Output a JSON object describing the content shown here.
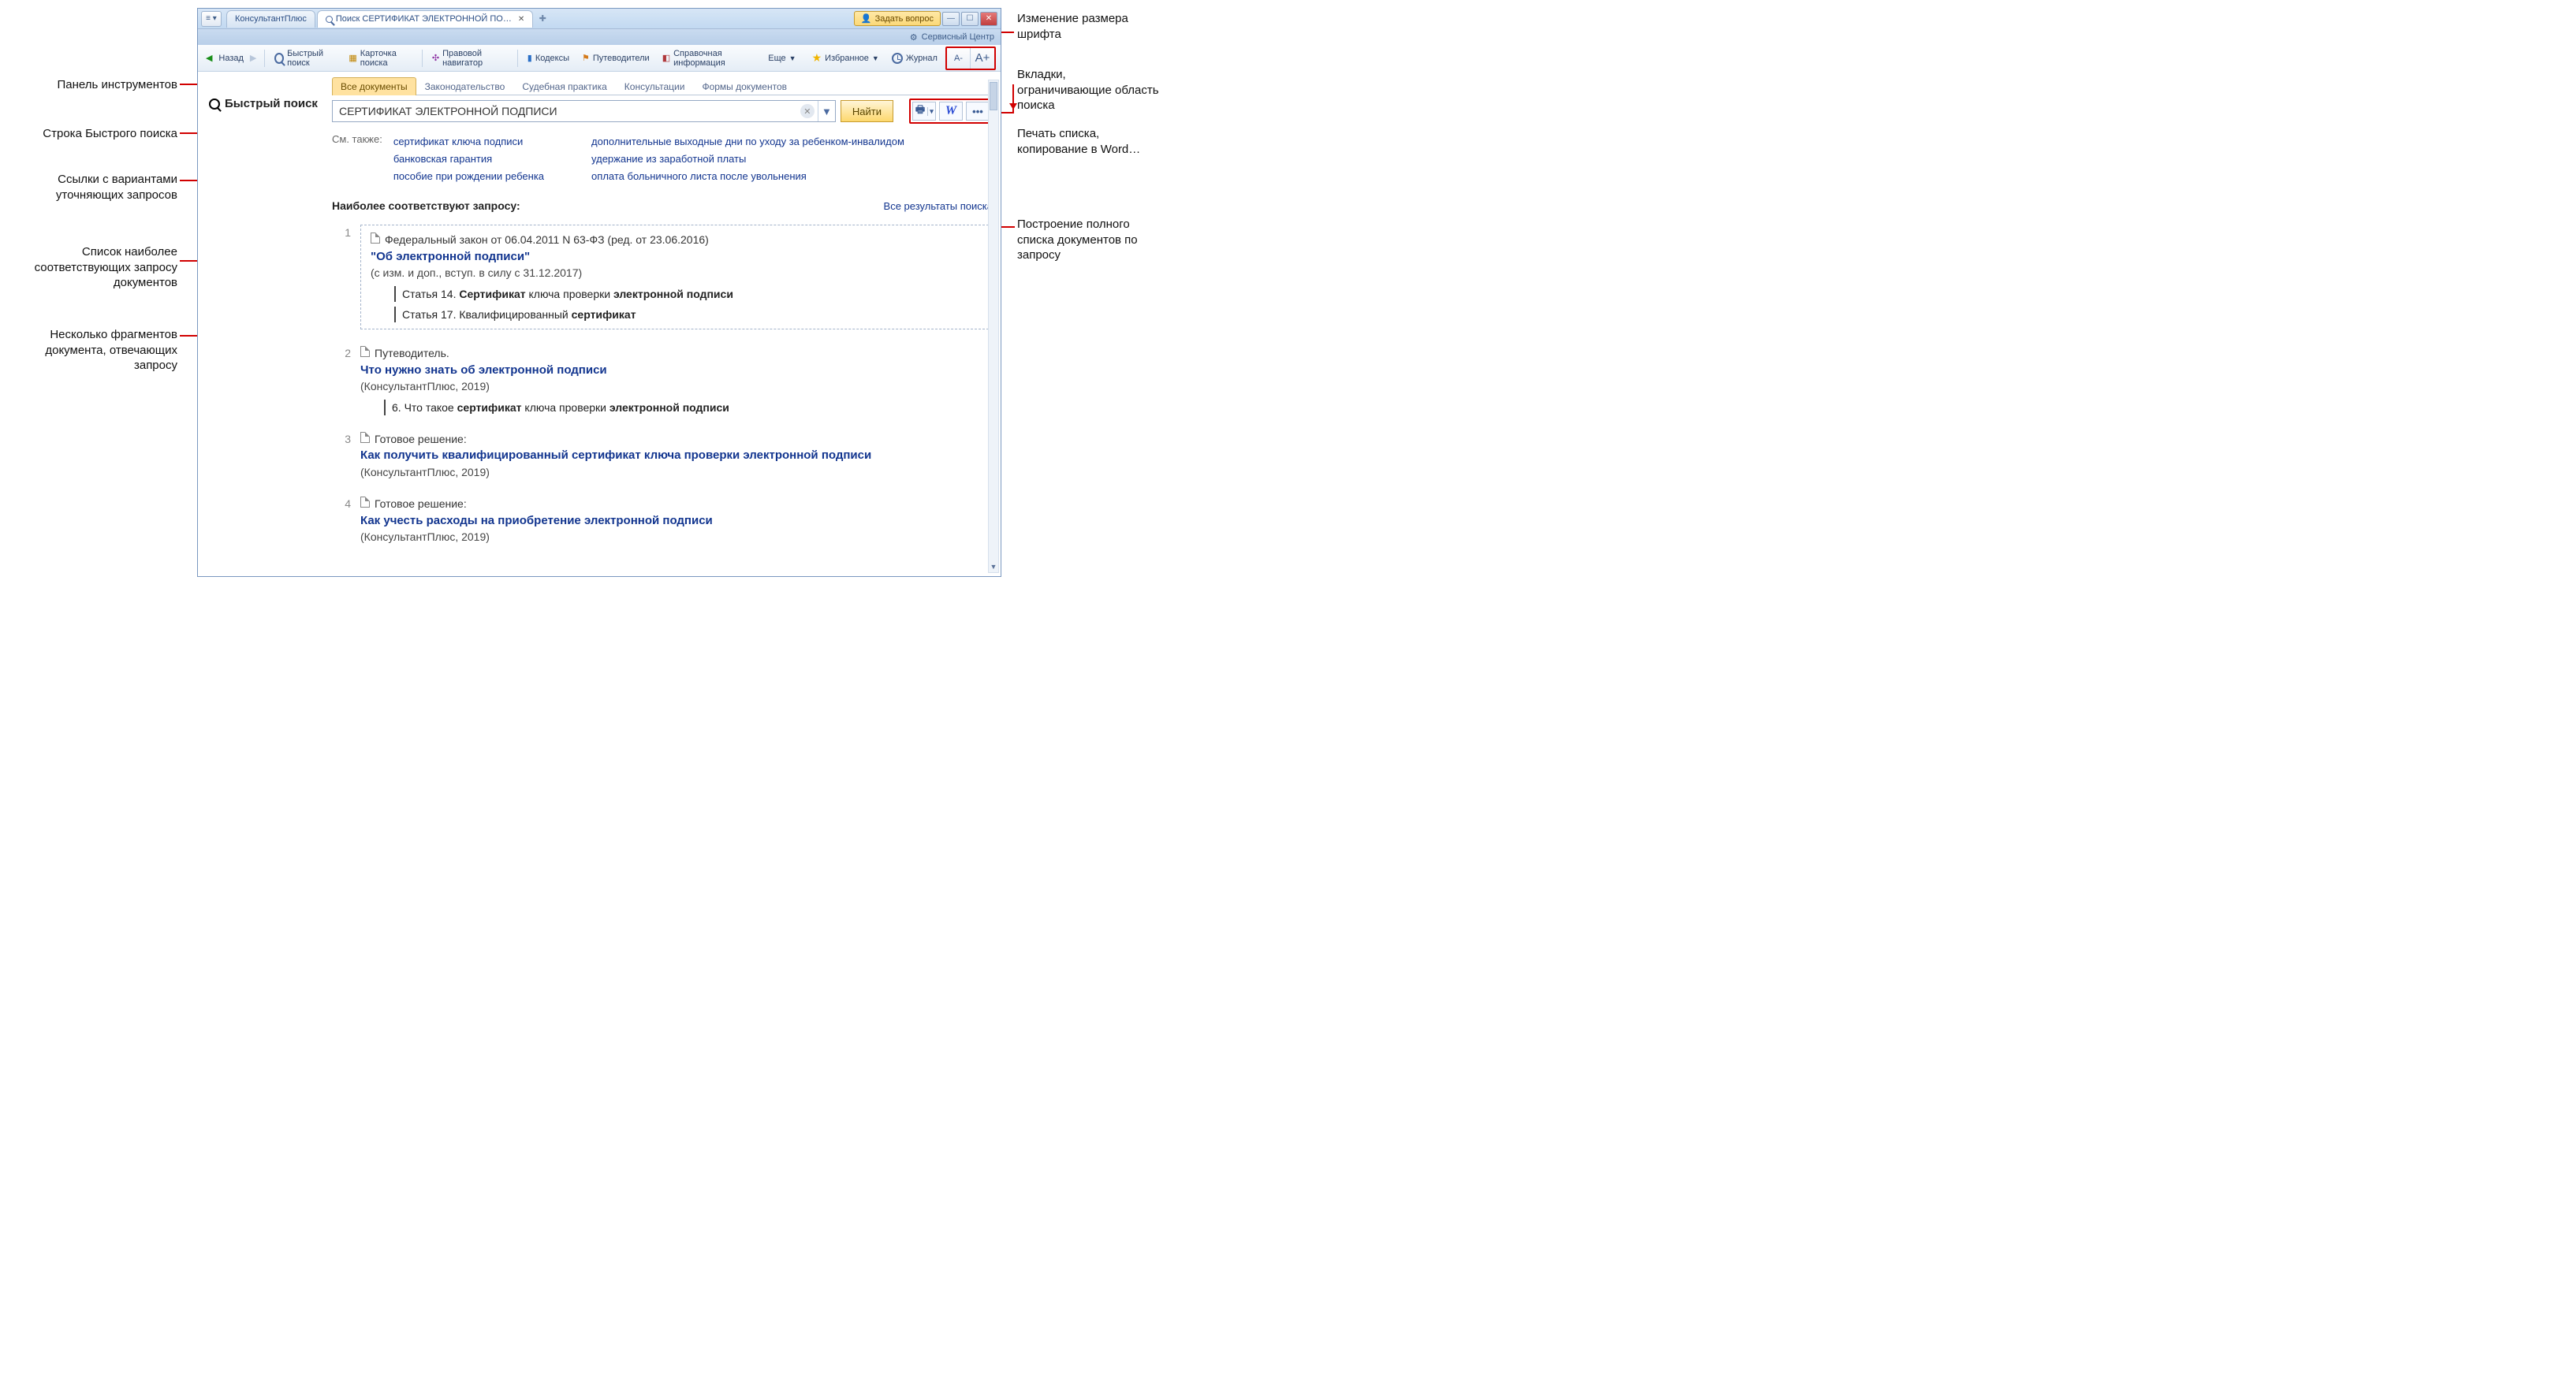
{
  "annotations": {
    "left": [
      "Панель инструментов",
      "Строка Быстрого поиска",
      "Ссылки с вариантами уточняющих запросов",
      "Список наиболее соответствующих запросу документов",
      "Несколько фрагментов документа, отвечающих запросу"
    ],
    "right": [
      "Изменение размера шрифта",
      "Вкладки, ограничивающие область поиска",
      "Печать списка, копирование в Word…",
      "Построение полного списка документов по запросу"
    ]
  },
  "titlebar": {
    "product": "КонсультантПлюс",
    "tab_prefix": "Поиск ",
    "tab_text": "СЕРТИФИКАТ ЭЛЕКТРОННОЙ ПО…",
    "ask": "Задать вопрос",
    "service": "Сервисный Центр"
  },
  "toolbar": {
    "back": "Назад",
    "quick_search": "Быстрый поиск",
    "card_search": "Карточка поиска",
    "law_nav": "Правовой навигатор",
    "codices": "Кодексы",
    "guides": "Путеводители",
    "reference": "Справочная информация",
    "more": "Еще",
    "favorites": "Избранное",
    "journal": "Журнал",
    "font_minus": "A-",
    "font_plus": "A+"
  },
  "quick_search_label": "Быстрый поиск",
  "scope_tabs": [
    "Все документы",
    "Законодательство",
    "Судебная практика",
    "Консультации",
    "Формы документов"
  ],
  "search": {
    "value": "СЕРТИФИКАТ ЭЛЕКТРОННОЙ ПОДПИСИ",
    "find": "Найти"
  },
  "actions": {
    "w": "W",
    "more": "•••"
  },
  "see_also": {
    "label": "См. также:",
    "col1": [
      "сертификат ключа подписи",
      "банковская гарантия",
      "пособие при рождении ребенка"
    ],
    "col2": [
      "дополнительные выходные дни по уходу за ребенком-инвалидом",
      "удержание из заработной платы",
      "оплата больничного листа после увольнения"
    ]
  },
  "results": {
    "header": "Наиболее соответствуют запросу:",
    "all_link": "Все результаты поиска",
    "items": [
      {
        "num": "1",
        "meta": "Федеральный закон от 06.04.2011 N 63-ФЗ (ред. от 23.06.2016)",
        "title_pre": "\"Об ",
        "title_hl": "электронной подписи",
        "title_post": "\"",
        "sub": "(с изм. и доп., вступ. в силу с 31.12.2017)",
        "frags": [
          {
            "pre": "Статья 14. ",
            "b1": "Сертификат",
            "mid": " ключа проверки ",
            "b2": "электронной подписи",
            "post": ""
          },
          {
            "pre": "Статья 17. Квалифицированный ",
            "b1": "сертификат",
            "mid": "",
            "b2": "",
            "post": ""
          }
        ]
      },
      {
        "num": "2",
        "meta": "Путеводитель.",
        "title_pre": "Что нужно знать об ",
        "title_hl": "электронной подписи",
        "title_post": "",
        "sub": "(КонсультантПлюс, 2019)",
        "frags": [
          {
            "pre": "6. Что такое ",
            "b1": "сертификат",
            "mid": " ключа проверки ",
            "b2": "электронной подписи",
            "post": ""
          }
        ]
      },
      {
        "num": "3",
        "meta": "Готовое решение:",
        "title_pre": "Как получить квалифицированный ",
        "title_hl": "сертификат",
        "title_mid": " ключа проверки ",
        "title_hl2": "электронной подписи",
        "title_post": "",
        "sub": "(КонсультантПлюс, 2019)"
      },
      {
        "num": "4",
        "meta": "Готовое решение:",
        "title_pre": "Как учесть расходы на приобретение ",
        "title_hl": "электронной подписи",
        "title_post": "",
        "sub": "(КонсультантПлюс, 2019)"
      }
    ]
  }
}
